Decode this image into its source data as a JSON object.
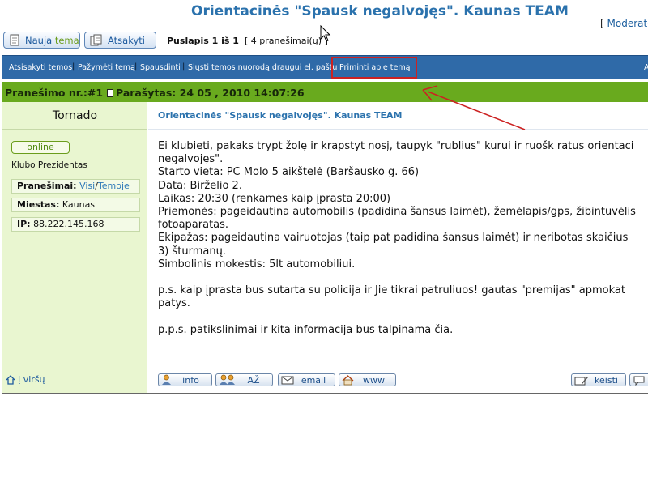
{
  "topic": {
    "title": "Orientacinės \"Spausk negalvojęs\". Kaunas TEAM",
    "moderator_prefix": "[",
    "moderator_label": "Moderato"
  },
  "top_buttons": {
    "new_topic_part1": "Nauja",
    "new_topic_part2": "tema",
    "reply": "Atsakyti"
  },
  "pagination": {
    "page_label": "Puslapis 1 iš 1",
    "count": "[ 4 pranešimai(ų) ]"
  },
  "action_bar": {
    "items": [
      "Atsisakyti temos",
      "Pažymėti temą",
      "Spausdinti",
      "Siųsti temos nuorodą draugui el. paštu",
      "Priminti apie temą"
    ],
    "separator": "|",
    "right_label": "A"
  },
  "post": {
    "number_label": "Pranešimo nr.:#1",
    "date_label": "Parašytas: 24 05 , 2010 14:07:26",
    "subject": "Orientacinės \"Spausk negalvojęs\". Kaunas TEAM",
    "message_lines": [
      "Ei klubieti, pakaks trypt žolę ir krapstyt nosį, taupyk \"rublius\" kurui ir ruošk ratus orientaci",
      "negalvojęs\".",
      "Starto vieta: PC Molo 5 aikštelė (Baršausko g. 66)",
      "Data: Birželio 2.",
      "Laikas: 20:30 (renkamės kaip įprasta 20:00)",
      "Priemonės: pageidautina automobilis (padidina šansus laimėt), žemėlapis/gps, žibintuvėlis",
      "fotoaparatas.",
      "Ekipažas: pageidautina vairuotojas (taip pat padidina šansus laimėt) ir neribotas skaičius",
      "3) šturmanų.",
      "Simbolinis mokestis: 5lt automobiliui.",
      "",
      "p.s. kaip įprasta bus sutarta su policija ir Jie tikrai patruliuos! gautas \"premijas\" apmokat",
      "patys.",
      "",
      "p.p.s. patikslinimai ir kita informacija bus talpinama čia."
    ]
  },
  "author": {
    "username": "Tornado",
    "status": "online",
    "rank": "Klubo Prezidentas",
    "posts_label": "Pranešimai:",
    "posts_all": "Visi",
    "posts_slash": "/",
    "posts_topic": "Temoje",
    "city_label": "Miestas:",
    "city": "Kaunas",
    "ip_label": "IP:",
    "ip": "88.222.145.168"
  },
  "footer": {
    "back_to_top": "Į viršų",
    "info": "info",
    "pm": "AŽ",
    "email": "email",
    "www": "www",
    "edit": "keisti"
  },
  "colors": {
    "accent_blue": "#2b72ad",
    "action_bar": "#2f6aa8",
    "post_header": "#69aa1e",
    "sidebar": "#e9f6d0",
    "annotation_red": "#cc2222"
  }
}
